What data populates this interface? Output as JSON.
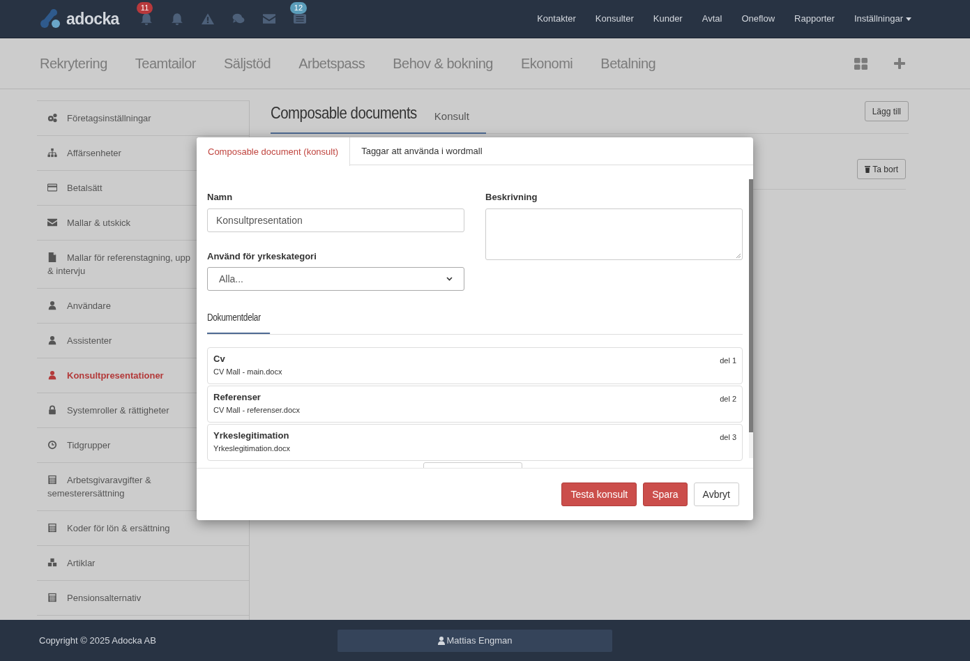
{
  "top_nav": {
    "logo": "adocka",
    "icons": [
      {
        "kind": "bell",
        "badge": "11",
        "color": "#b8393c"
      },
      {
        "kind": "bell"
      },
      {
        "kind": "warning"
      },
      {
        "kind": "comments"
      },
      {
        "kind": "envelope"
      },
      {
        "kind": "list",
        "badge": "12",
        "color": "#5b9dba"
      }
    ],
    "links": [
      "Kontakter",
      "Konsulter",
      "Kunder",
      "Avtal",
      "Oneflow",
      "Rapporter"
    ],
    "settings_menu": "Inställningar"
  },
  "module_tabs": [
    "Rekrytering",
    "Teamtailor",
    "Säljstöd",
    "Arbetspass",
    "Behov & bokning",
    "Ekonomi",
    "Betalning"
  ],
  "sidebar": {
    "items": [
      {
        "label": "Företagsinställningar",
        "kind": "cogs",
        "selected": false
      },
      {
        "label": "Affärsenheter",
        "kind": "sitemap",
        "selected": false
      },
      {
        "label": "Betalsätt",
        "kind": "card",
        "selected": false
      },
      {
        "label": "Mallar & utskick",
        "kind": "envelope",
        "selected": false
      },
      {
        "label": "Mallar för referenstagning, upp & intervju",
        "kind": "file",
        "selected": false
      },
      {
        "label": "Användare",
        "kind": "user",
        "selected": false
      },
      {
        "label": "Assistenter",
        "kind": "user",
        "selected": false
      },
      {
        "label": "Konsultpresentationer",
        "kind": "user",
        "selected": true
      },
      {
        "label": "Systemroller & rättigheter",
        "kind": "lock",
        "selected": false
      },
      {
        "label": "Tidgrupper",
        "kind": "clock",
        "selected": false
      },
      {
        "label": "Arbetsgivaravgifter & semesterersättning",
        "kind": "calculator",
        "selected": false
      },
      {
        "label": "Koder för lön & ersättning",
        "kind": "calculator",
        "selected": false
      },
      {
        "label": "Artiklar",
        "kind": "cubes",
        "selected": false
      },
      {
        "label": "Pensionsalternativ",
        "kind": "calculator",
        "selected": false
      }
    ]
  },
  "page": {
    "title": "Composable documents",
    "subtitle": "Konsult",
    "add_button": "Lägg till",
    "delete_button": "Ta bort"
  },
  "modal": {
    "tabs": [
      {
        "label": "Composable document (konsult)",
        "selected": true
      },
      {
        "label": "Taggar att använda i wordmall",
        "selected": false
      }
    ],
    "name_label": "Namn",
    "name_value": "Konsultpresentation",
    "description_label": "Beskrivning",
    "category_label": "Använd för yrkeskategori",
    "category_value": "Alla...",
    "section_title": "Dokumentdelar",
    "parts": [
      {
        "title": "Cv",
        "file": "CV Mall - main.docx",
        "order": "del 1"
      },
      {
        "title": "Referenser",
        "file": "CV Mall - referenser.docx",
        "order": "del 2"
      },
      {
        "title": "Yrkeslegitimation",
        "file": "Yrkeslegitimation.docx",
        "order": "del 3"
      }
    ],
    "buttons": [
      {
        "label": "Testa konsult",
        "kind": "danger"
      },
      {
        "label": "Spara",
        "kind": "danger"
      },
      {
        "label": "Avbryt",
        "kind": "default"
      }
    ]
  },
  "footer": {
    "copyright": "Copyright © 2025 Adocka AB",
    "user": "Mattias Engman"
  }
}
